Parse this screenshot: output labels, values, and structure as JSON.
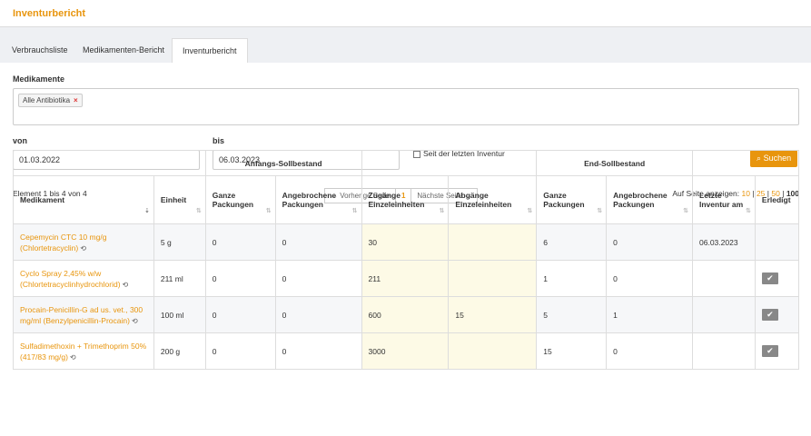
{
  "header": {
    "title": "Inventurbericht"
  },
  "tabs": [
    {
      "label": "Verbrauchsliste"
    },
    {
      "label": "Medikamenten-Bericht"
    },
    {
      "label": "Inventurbericht"
    }
  ],
  "filters": {
    "medikamente_label": "Medikamente",
    "chip_label": "Alle Antibiotika",
    "chip_remove": "×",
    "von_label": "von",
    "von_value": "01.03.2022",
    "bis_label": "bis",
    "bis_value": "06.03.2023",
    "since_last_label": "Seit der letzten Inventur",
    "search_button": "Suchen"
  },
  "pagination": {
    "element_info": "Element 1 bis 4 von 4",
    "prev": "← Vorherige Seite",
    "current": "1",
    "next": "Nächste Seite →",
    "page_size_label": "Auf Seite anzeigen:",
    "sizes": [
      "10",
      "25",
      "50",
      "100"
    ],
    "sep": "|"
  },
  "table": {
    "group_headers": {
      "start": "Anfangs-Sollbestand",
      "end": "End-Sollbestand"
    },
    "columns": [
      "Medikament",
      "Einheit",
      "Ganze Packungen",
      "Angebrochene Packungen",
      "Zugänge Einzeleinheiten",
      "Abgänge Einzeleinheiten",
      "Ganze Packungen",
      "Angebrochene Packungen",
      "Letzte Inventur am",
      "Erledigt"
    ],
    "sort_icon": "⇅",
    "sort_active_icon": "⇣",
    "history_icon": "⟲",
    "done_icon": "✔",
    "rows": [
      {
        "med": "Cepemycin CTC 10 mg/g (Chlortetracyclin)",
        "unit": "5 g",
        "start_full": "0",
        "start_open": "0",
        "in": "30",
        "out": "",
        "end_full": "6",
        "end_open": "0",
        "last": "06.03.2023",
        "done": false
      },
      {
        "med": "Cyclo Spray 2,45% w/w (Chlortetracyclinhydrochlorid)",
        "unit": "211 ml",
        "start_full": "0",
        "start_open": "0",
        "in": "211",
        "out": "",
        "end_full": "1",
        "end_open": "0",
        "last": "",
        "done": true
      },
      {
        "med": "Procain-Penicillin-G ad us. vet., 300 mg/ml (Benzylpenicillin-Procain)",
        "unit": "100 ml",
        "start_full": "0",
        "start_open": "0",
        "in": "600",
        "out": "15",
        "end_full": "5",
        "end_open": "1",
        "last": "",
        "done": true
      },
      {
        "med": "Sulfadimethoxin + Trimethoprim 50% (417/83 mg/g)",
        "unit": "200 g",
        "start_full": "0",
        "start_open": "0",
        "in": "3000",
        "out": "",
        "end_full": "15",
        "end_open": "0",
        "last": "",
        "done": true
      }
    ]
  }
}
